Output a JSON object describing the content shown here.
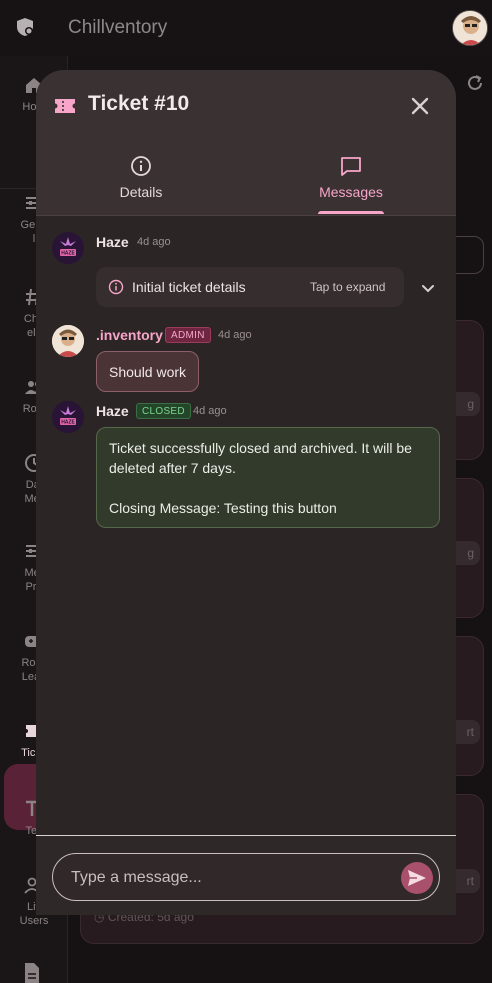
{
  "app": {
    "title": "Chillventory"
  },
  "rail": {
    "items": [
      {
        "label": "Hom",
        "icon": "home-icon"
      },
      {
        "label": "Gene\nl",
        "icon": "sliders-icon"
      },
      {
        "label": "Cha\nels",
        "icon": "hash-icon"
      },
      {
        "label": "Role",
        "icon": "people-icon"
      },
      {
        "label": "Dai\nMer",
        "icon": "clock-icon"
      },
      {
        "label": "Mer\nPre",
        "icon": "sliders-icon"
      },
      {
        "label": "Rock\nLeag",
        "icon": "gamepad-icon"
      },
      {
        "label": "Ticke",
        "icon": "ticket-icon"
      },
      {
        "label": "Tex",
        "icon": "text-icon"
      },
      {
        "label": "Liv\nUsers",
        "icon": "users-icon"
      }
    ]
  },
  "background": {
    "created_text": "Created: 5d ago",
    "chips": [
      "g",
      "g",
      "rt",
      "rt"
    ]
  },
  "modal": {
    "title": "Ticket #10",
    "tabs": [
      {
        "label": "Details",
        "icon": "info-icon"
      },
      {
        "label": "Messages",
        "icon": "chat-icon"
      }
    ],
    "active_tab": "Messages",
    "messages": [
      {
        "author": "Haze",
        "time": "4d ago",
        "expander": {
          "title": "Initial ticket details",
          "hint": "Tap to expand"
        }
      },
      {
        "author": ".inventory",
        "badge": "ADMIN",
        "time": "4d ago",
        "text": "Should work"
      },
      {
        "author": "Haze",
        "badge": "CLOSED",
        "time": "4d ago",
        "text_line1": "Ticket successfully closed and archived. It will be",
        "text_line2": "deleted after 7 days.",
        "text_line3": "Closing Message: Testing this button"
      }
    ],
    "composer": {
      "placeholder": "Type a message..."
    }
  },
  "colors": {
    "accent": "#f7a5c8",
    "admin_badge": "#6e2540",
    "closed_badge": "#23452a",
    "send_button": "#a8506c"
  }
}
